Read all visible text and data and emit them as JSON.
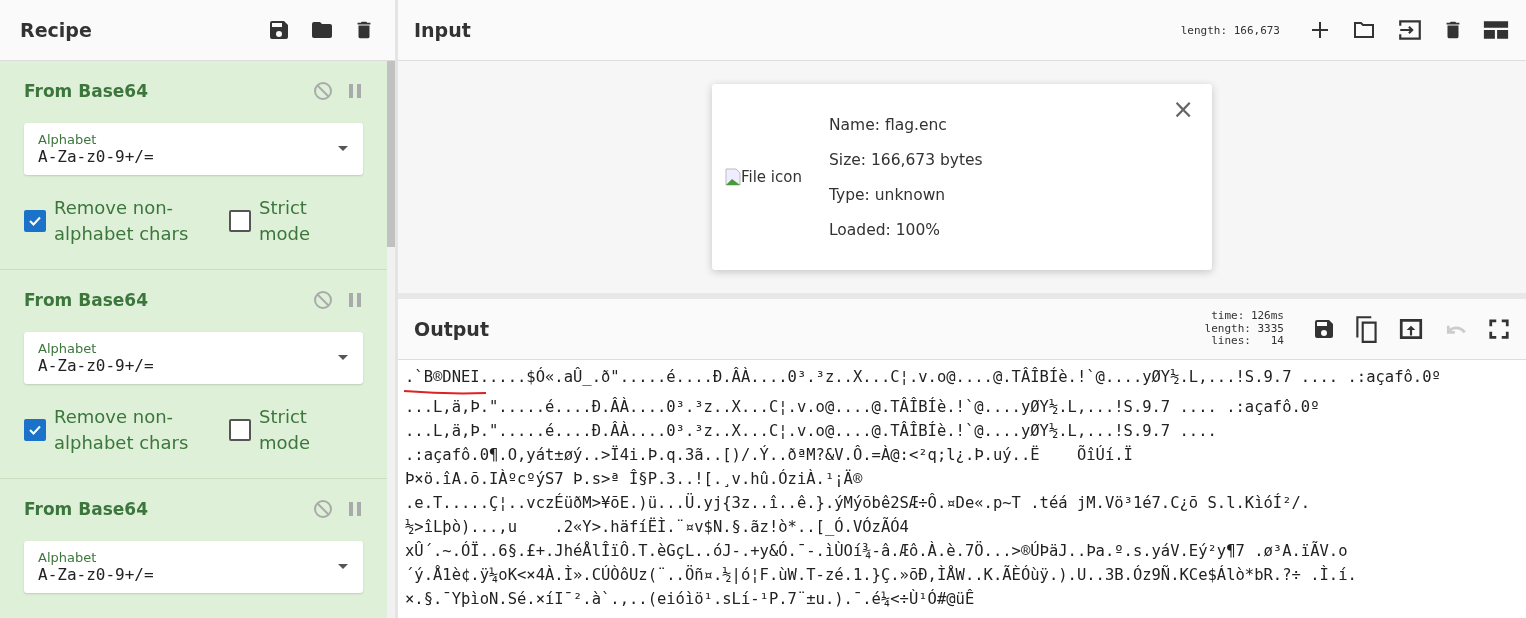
{
  "recipe": {
    "title": "Recipe",
    "operations": [
      {
        "title": "From Base64",
        "field": {
          "label": "Alphabet",
          "value": "A-Za-z0-9+/="
        },
        "options": [
          {
            "label": "Remove non-alphabet chars",
            "checked": true
          },
          {
            "label": "Strict mode",
            "checked": false
          }
        ]
      },
      {
        "title": "From Base64",
        "field": {
          "label": "Alphabet",
          "value": "A-Za-z0-9+/="
        },
        "options": [
          {
            "label": "Remove non-alphabet chars",
            "checked": true
          },
          {
            "label": "Strict mode",
            "checked": false
          }
        ]
      },
      {
        "title": "From Base64",
        "field": {
          "label": "Alphabet",
          "value": "A-Za-z0-9+/="
        }
      }
    ]
  },
  "input": {
    "title": "Input",
    "length": "length: 166,673",
    "file": {
      "icon_alt": "File icon",
      "details": [
        "Name: flag.enc",
        "Size: 166,673 bytes",
        "Type: unknown",
        "Loaded: 100%"
      ],
      "close": "×"
    }
  },
  "output": {
    "title": "Output",
    "stats": [
      "time: 126ms",
      "length: 3335",
      "lines:   14"
    ],
    "undo_disabled": true,
    "lines": [
      ".`B®DNEI.....$Ó«.aÛ_.ð\".....é....Ð.ÂÀ....0³.³z..X...C¦.v.o@....@.TÂÎBÍè.!`@....yØY½.L,...!S.9.7 .... .:açafô.0º",
      "...L,ä,Þ.\".....é....Ð.ÂÀ....0³.³z..X...C¦.v.o@....@.TÂÎBÍè.!`@....yØY½.L,...!S.9.7 .... .:açafô.0º",
      "...L,ä,Þ.\".....é....Ð.ÂÀ....0³.³z..X...C¦.v.o@....@.TÂÎBÍè.!`@....yØY½.L,...!S.9.7 ....",
      ".:açafô.0¶.O,yát±øý..>Ï4i.Þ.q.3ã..[)/.Ý..ðªM?&V.Ô.=À@:<²q;l¿.Þ.uý..Ë    ÕîÚí.Ï",
      "Þ×ö.îA.õ.IÀºcºýS7 Þ.s>ª Î§P.3..![.¸v.hû.ÓziÀ.¹¡Ä®",
      ".e.T.....Ç¦..vczÉüðM>¥õE.)ü...Ü.yj{3z..î..ê.}.ýMýõbê2SÆ÷Ô.¤De«.p~T .téá jM.Vö³1é7.C¿õ S.l.KìóÍ²/.",
      "½>îLþò)...,u    .2«Y>.häfíËÌ.¨¤v$N.§.ãz!ò*..[_Ó.VÓzÃÓ4",
      "xÛ´.~.ÓÏ..6§.£+.JhéÅlÎïÔ.T.èGçL..óJ-.+y&Ó.¯-.ìÙOí¾-â.Æô.À.è.7Ö...>®ÚÞäJ..Þa.º.s.yáV.Eý²y¶7 .ø³A.ïÃV.o",
      "´ý.Å1è¢.ÿ¼oK<×4À.Ì».CÚÒôUz(¨..Öñ¤.½|ó¦F.ùW.T-zé.1.}Ç.»õÐ,ÌÅW..K.ÃÈÓùÿ.).U..3B.Óz9Ñ.KCe$Álò*bR.?÷ .Ì.í.",
      "×.§.¯YþìoN.Sé.×íI¯².à`.,..(eióìö¹.sLí-¹P.7¨±u.).¯.é¼<÷Ù¹Ó#@üÊ"
    ]
  }
}
